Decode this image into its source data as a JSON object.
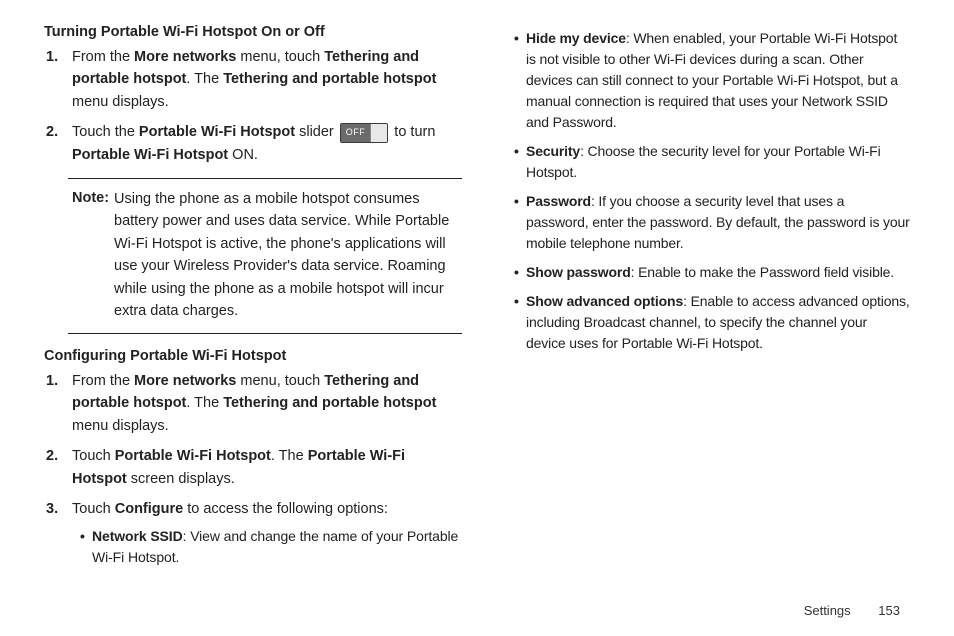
{
  "left": {
    "section1": {
      "heading": "Turning Portable Wi-Fi Hotspot On or Off",
      "step1_a": "From the ",
      "step1_b": "More networks",
      "step1_c": " menu, touch ",
      "step1_d": "Tethering and portable hotspot",
      "step1_e": ". The ",
      "step1_f": "Tethering and portable hotspot",
      "step1_g": " menu displays.",
      "step2_a": "Touch the ",
      "step2_b": "Portable Wi-Fi Hotspot",
      "step2_c": " slider ",
      "slider_label": "OFF",
      "step2_d": " to turn ",
      "step2_e": "Portable Wi-Fi Hotspot",
      "step2_f": " ON.",
      "note_label": "Note:",
      "note_body": "Using the phone as a mobile hotspot consumes battery power and uses data service. While Portable Wi-Fi Hotspot is active, the phone's applications will use your Wireless Provider's data service. Roaming while using the phone as a mobile hotspot will incur extra data charges."
    },
    "section2": {
      "heading": "Configuring Portable Wi-Fi Hotspot",
      "step1_a": "From the ",
      "step1_b": "More networks",
      "step1_c": " menu, touch ",
      "step1_d": "Tethering and portable hotspot",
      "step1_e": ". The ",
      "step1_f": "Tethering and portable hotspot",
      "step1_g": " menu displays.",
      "step2_a": "Touch ",
      "step2_b": "Portable Wi-Fi Hotspot",
      "step2_c": ". The ",
      "step2_d": "Portable Wi-Fi Hotspot",
      "step2_e": " screen displays.",
      "step3_a": "Touch ",
      "step3_b": "Configure",
      "step3_c": " to access the following options:",
      "bullet1_a": "Network SSID",
      "bullet1_b": ": View and change the name of your Portable Wi-Fi Hotspot."
    }
  },
  "right": {
    "b1_a": "Hide my device",
    "b1_b": ": When enabled, your Portable Wi-Fi Hotspot is not visible to other Wi-Fi devices during a scan. Other devices can still connect to your Portable Wi-Fi Hotspot, but a manual connection is required that uses your Network SSID and Password.",
    "b2_a": "Security",
    "b2_b": ": Choose the security level for your Portable Wi-Fi Hotspot.",
    "b3_a": "Password",
    "b3_b": ": If you choose a security level that uses a password, enter the password. By default, the password is your mobile telephone number.",
    "b4_a": "Show password",
    "b4_b": ": Enable to make the Password field visible.",
    "b5_a": "Show advanced options",
    "b5_b": ": Enable to access advanced options, including Broadcast channel, to specify the channel your device uses for Portable Wi-Fi Hotspot."
  },
  "footer": {
    "section": "Settings",
    "page": "153"
  }
}
